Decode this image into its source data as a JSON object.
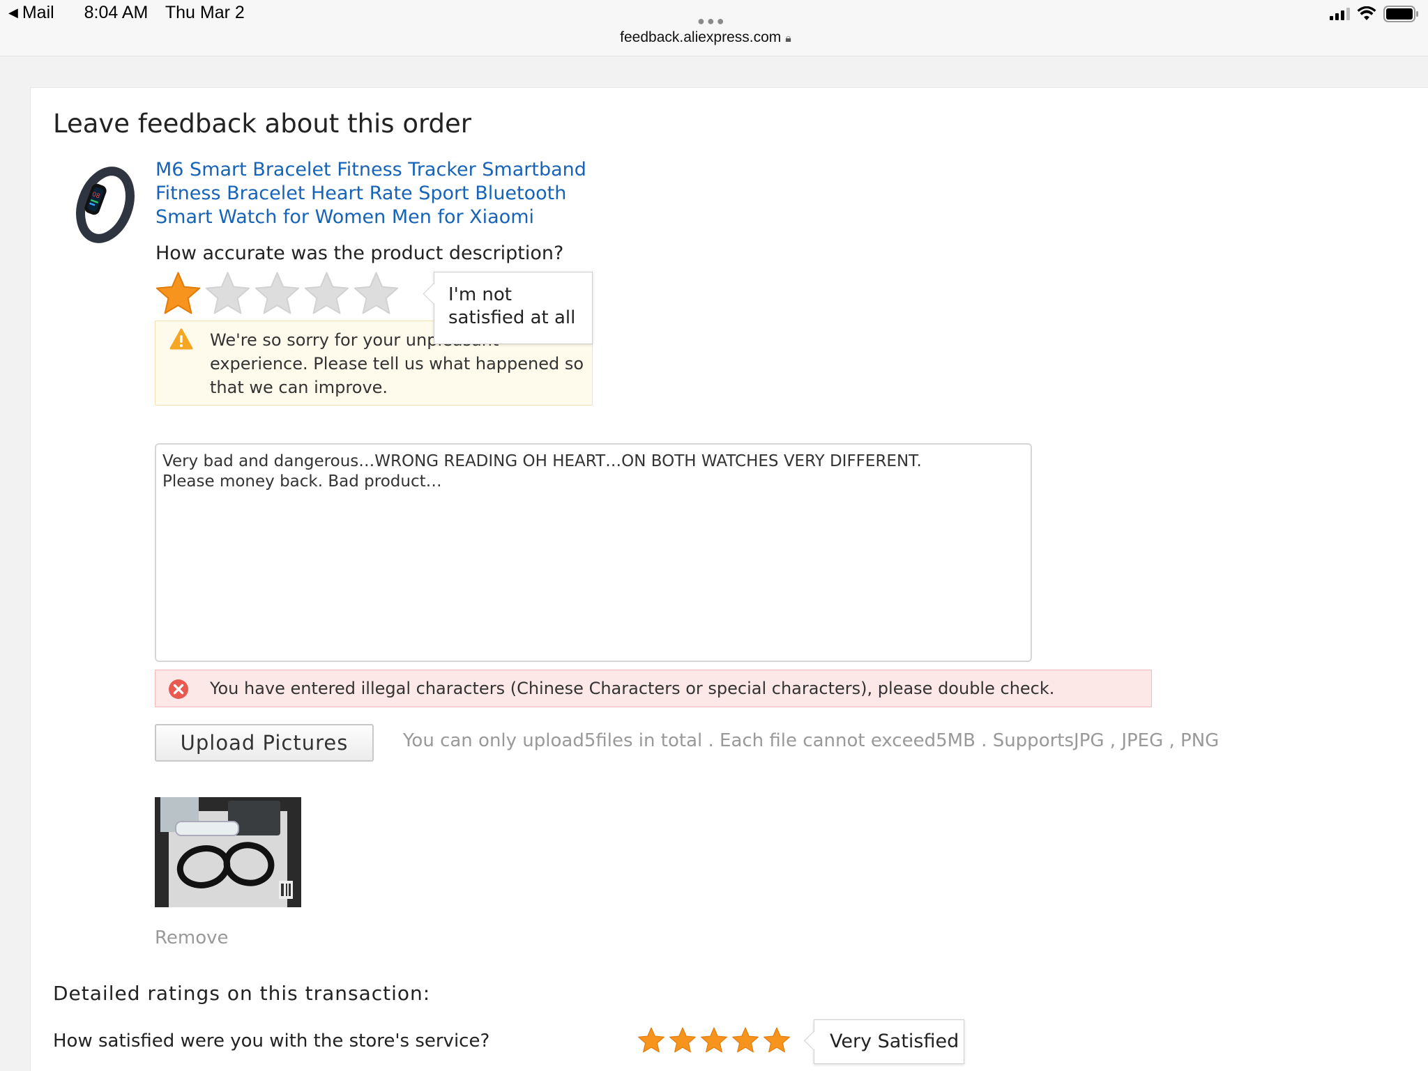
{
  "status_bar": {
    "back_label": "Mail",
    "time": "8:04 AM",
    "date": "Thu Mar 2",
    "url": "feedback.aliexpress.com",
    "icons": [
      "back-arrow-icon",
      "more-dots-icon",
      "lock-icon",
      "cellular-signal-icon",
      "wifi-icon",
      "battery-icon"
    ]
  },
  "page": {
    "title": "Leave feedback about this order"
  },
  "product": {
    "name": "M6 Smart Bracelet Fitness Tracker Smartband Fitness Bracelet Heart Rate Sport Bluetooth Smart Watch for Women Men for Xiaomi",
    "image_icon": "fitness-band-icon"
  },
  "description_rating": {
    "question": "How accurate was the product description?",
    "rating": 1,
    "max": 5,
    "tooltip": "I'm not satisfied at all",
    "colors": {
      "filled": "#f7941d",
      "empty": "#dddddd"
    }
  },
  "warning": {
    "text": "We're so sorry for your unpleasant experience. Please tell us what happened so that we can improve.",
    "icon": "warning-triangle-icon",
    "color": "#f5a623"
  },
  "review": {
    "value": "Very bad and dangerous…WRONG READING OH HEART…ON BOTH WATCHES VERY DIFFERENT.\nPlease money back. Bad product…"
  },
  "error": {
    "text": "You have entered illegal characters (Chinese Characters or special characters), please double check.",
    "icon": "error-x-circle-icon",
    "color": "#e85a4f"
  },
  "upload": {
    "button_label": "Upload Pictures",
    "hint": "You can only upload5files in total . Each file cannot exceed5MB . SupportsJPG , JPEG , PNG",
    "remove_label": "Remove"
  },
  "detailed": {
    "heading": "Detailed ratings on this transaction:",
    "service_question": "How satisfied were you with the store's service?",
    "service_rating": 5,
    "service_max": 5,
    "service_tooltip": "Very Satisfied"
  }
}
